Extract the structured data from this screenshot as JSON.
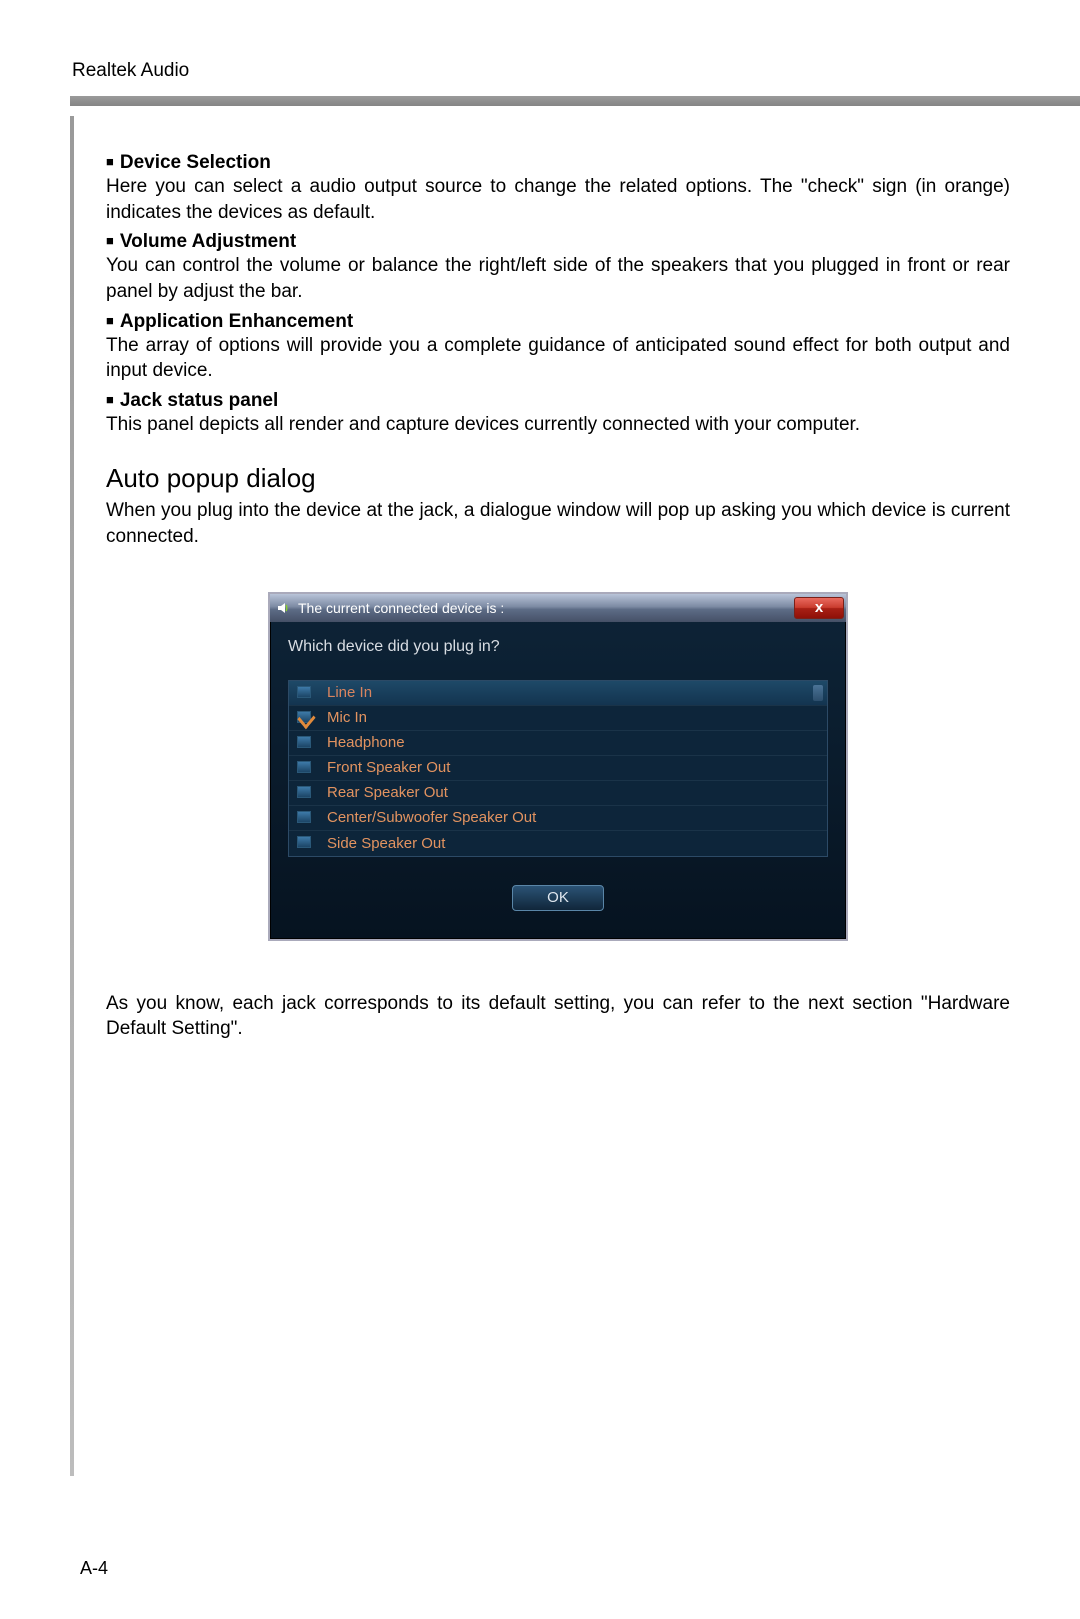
{
  "header": {
    "title": "Realtek Audio"
  },
  "sections": [
    {
      "title": "Device Selection",
      "body": "Here you can select a audio output source to change the related options. The \"check\" sign (in orange) indicates the devices as default."
    },
    {
      "title": "Volume Adjustment",
      "body": "You can control the volume or balance the right/left side of the speakers that you plugged in front or rear panel by adjust the bar."
    },
    {
      "title": "Application Enhancement",
      "body": "The array of options will provide you a complete guidance of anticipated sound effect for both output and input device."
    },
    {
      "title": "Jack status panel",
      "body": "This panel depicts all render and capture devices currently connected with your computer."
    }
  ],
  "auto_popup": {
    "heading": "Auto popup dialog",
    "intro": "When you plug into the device at the jack, a dialogue window will pop up asking you which device is current connected."
  },
  "dialog": {
    "title": "The current connected device is :",
    "close_label": "x",
    "prompt": "Which device did you plug in?",
    "devices": [
      {
        "label": "Line In",
        "selected": true,
        "checked": false
      },
      {
        "label": "Mic In",
        "selected": false,
        "checked": true
      },
      {
        "label": "Headphone",
        "selected": false,
        "checked": false
      },
      {
        "label": "Front Speaker Out",
        "selected": false,
        "checked": false
      },
      {
        "label": "Rear Speaker Out",
        "selected": false,
        "checked": false
      },
      {
        "label": "Center/Subwoofer Speaker Out",
        "selected": false,
        "checked": false
      },
      {
        "label": "Side Speaker Out",
        "selected": false,
        "checked": false
      }
    ],
    "ok_label": "OK"
  },
  "footer_text": "As you know, each jack corresponds to its default setting, you can refer to the next section \"Hardware Default Setting\".",
  "page_number": "A-4"
}
